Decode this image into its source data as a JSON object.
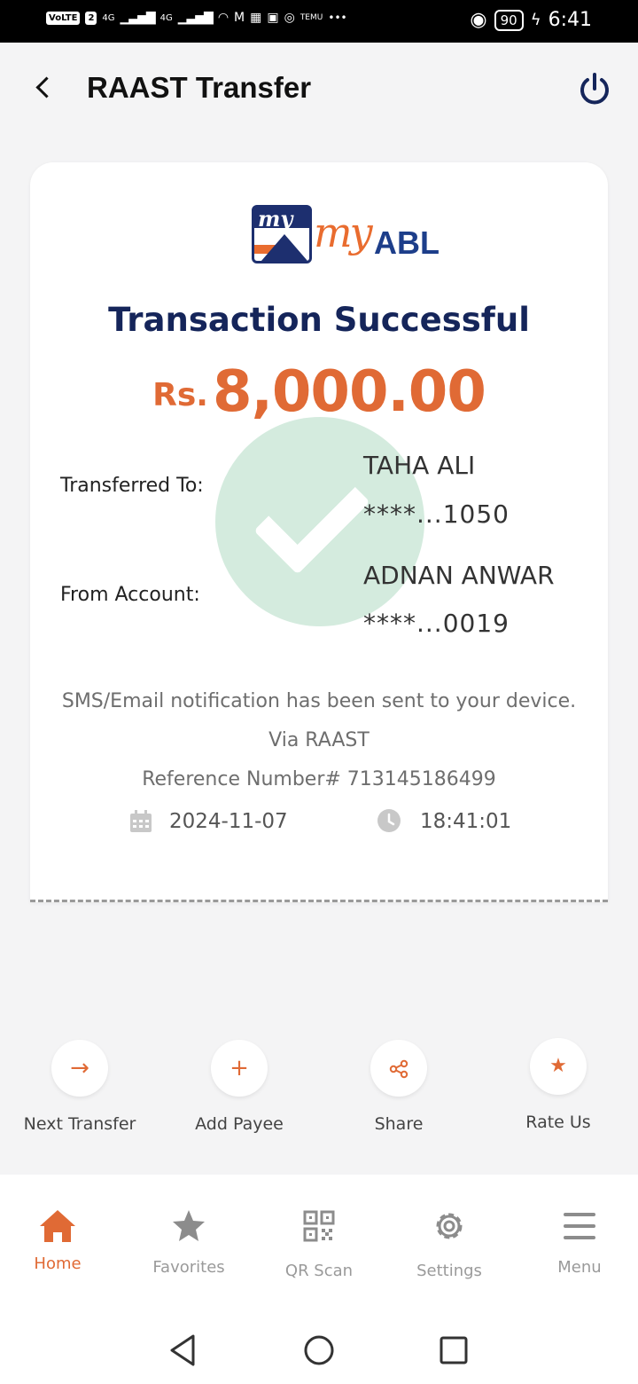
{
  "status_bar": {
    "left_chip": "VoLTE",
    "sim_slot": "2",
    "net1": "4G",
    "net2": "4G",
    "temu": "TEMU",
    "more": "•••",
    "battery": "90",
    "time": "6:41"
  },
  "header": {
    "title": "RAAST Transfer"
  },
  "receipt": {
    "logo_my_box": "my",
    "logo_my": "my",
    "logo_abl": "ABL",
    "title": "Transaction Successful",
    "currency": "Rs.",
    "amount": "8,000.00",
    "transferred_to_label": "Transferred To:",
    "transferred_to_name": "TAHA ALI",
    "transferred_to_account": "****...1050",
    "from_account_label": "From Account:",
    "from_account_name": "ADNAN ANWAR",
    "from_account_number": "****...0019",
    "notification": "SMS/Email notification has been sent to your device.",
    "via": "Via RAAST",
    "reference": "Reference Number# 713145186499",
    "date": "2024-11-07",
    "time": "18:41:01"
  },
  "actions": [
    {
      "label": "Next Transfer",
      "icon": "arrow-right-icon",
      "glyph": "→"
    },
    {
      "label": "Add Payee",
      "icon": "plus-icon",
      "glyph": "+"
    },
    {
      "label": "Share",
      "icon": "share-icon",
      "glyph": ""
    },
    {
      "label": "Rate Us",
      "icon": "star-icon",
      "glyph": "★"
    }
  ],
  "bottom_nav": [
    {
      "label": "Home",
      "icon": "home-icon",
      "active": true
    },
    {
      "label": "Favorites",
      "icon": "star-icon",
      "active": false
    },
    {
      "label": "QR Scan",
      "icon": "qr-code-icon",
      "active": false
    },
    {
      "label": "Settings",
      "icon": "gear-icon",
      "active": false
    },
    {
      "label": "Menu",
      "icon": "hamburger-menu-icon",
      "active": false
    }
  ],
  "colors": {
    "accent": "#e06a35",
    "title_navy": "#15255a",
    "success_green": "#aad7be",
    "nav_inactive": "#9a9a9a"
  }
}
